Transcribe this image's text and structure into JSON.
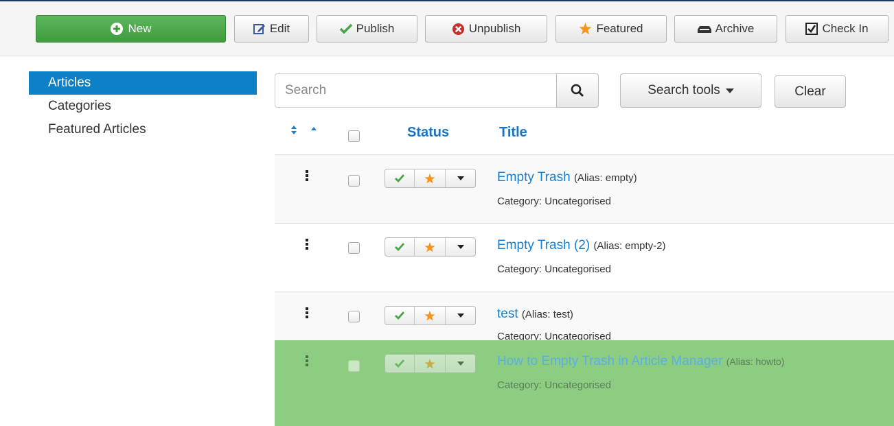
{
  "toolbar": {
    "new": "New",
    "edit": "Edit",
    "publish": "Publish",
    "unpublish": "Unpublish",
    "featured": "Featured",
    "archive": "Archive",
    "checkin": "Check In"
  },
  "sidebar": {
    "items": [
      {
        "label": "Articles",
        "active": true
      },
      {
        "label": "Categories",
        "active": false
      },
      {
        "label": "Featured Articles",
        "active": false
      }
    ]
  },
  "search": {
    "placeholder": "Search",
    "tools_label": "Search tools",
    "clear_label": "Clear"
  },
  "table": {
    "headers": {
      "status": "Status",
      "title": "Title"
    },
    "rows": [
      {
        "title": "Empty Trash",
        "alias": "(Alias: empty)",
        "category": "Category: Uncategorised"
      },
      {
        "title": "Empty Trash (2)",
        "alias": "(Alias: empty-2)",
        "category": "Category: Uncategorised"
      },
      {
        "title": "test",
        "alias": "(Alias: test)",
        "category": "Category: Uncategorised"
      }
    ],
    "dragging_row": {
      "title": "How to Empty Trash in Article Manager",
      "alias": "(Alias: howto)",
      "category": "Category: Uncategorised"
    }
  },
  "colors": {
    "brand_blue": "#0e80c8",
    "new_green": "#5bb75b",
    "drag_green": "#8ccd82",
    "check_green": "#46a546",
    "star_orange": "#f7941d",
    "unpublish_red": "#c9302c"
  },
  "icons": [
    "plus-circle-icon",
    "edit-icon",
    "check-icon",
    "times-circle-icon",
    "star-icon",
    "archive-icon",
    "checkbox-icon",
    "search-icon",
    "caret-down-icon",
    "sort-icon",
    "drag-handle-icon"
  ]
}
